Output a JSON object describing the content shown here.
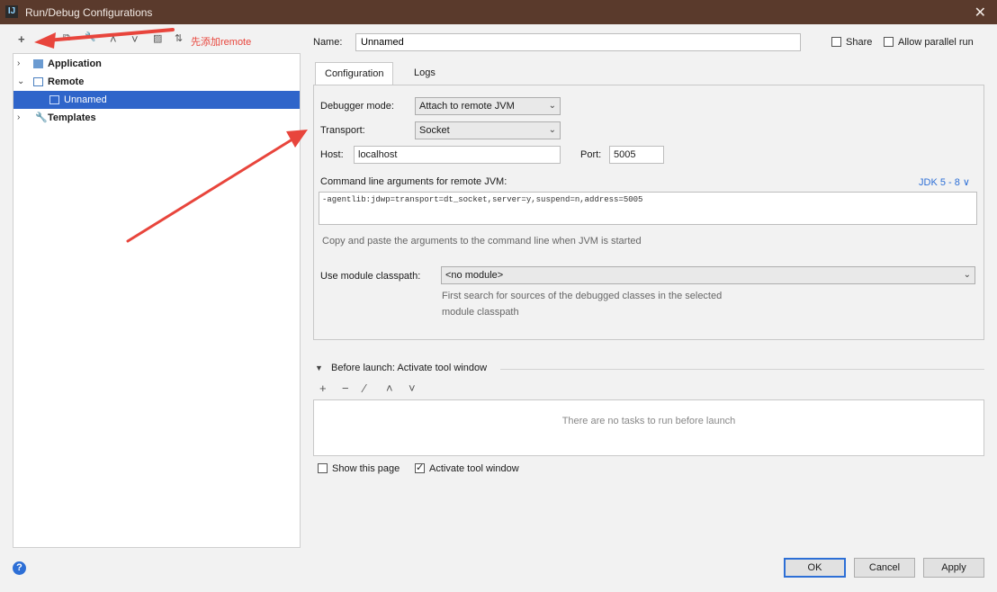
{
  "window": {
    "title": "Run/Debug Configurations",
    "app_icon": "IJ",
    "close_glyph": "✕"
  },
  "toolbar": {
    "add": "+",
    "remove": "−",
    "copy": "⧉",
    "edit": "🔧",
    "up": "˄",
    "down": "˅",
    "folder": "▨",
    "sort": "⇅",
    "annotation": "先添加remote"
  },
  "tree": {
    "application": "Application",
    "remote": "Remote",
    "unnamed": "Unnamed",
    "templates": "Templates",
    "collapsed_glyph": "›",
    "expanded_glyph": "⌄"
  },
  "form": {
    "name_label": "Name:",
    "name_value": "Unnamed",
    "share_label": "Share",
    "allow_parallel_label": "Allow parallel run",
    "tabs": [
      "Configuration",
      "Logs"
    ],
    "debugger_mode_label": "Debugger mode:",
    "debugger_mode_value": "Attach to remote JVM",
    "transport_label": "Transport:",
    "transport_value": "Socket",
    "host_label": "Host:",
    "host_value": "localhost",
    "port_label": "Port:",
    "port_value": "5005",
    "cmd_label": "Command line arguments for remote JVM:",
    "jdk_link": "JDK 5 - 8 ∨",
    "cmd_value": "-agentlib:jdwp=transport=dt_socket,server=y,suspend=n,address=5005",
    "cmd_hint": "Copy and paste the arguments to the command line when JVM is started",
    "module_label": "Use module classpath:",
    "module_value": "<no module>",
    "module_hint_1": "First search for sources of the debugged classes in the selected",
    "module_hint_2": "module classpath",
    "select_chevron": "⌄"
  },
  "before_launch": {
    "toggle": "▼",
    "title": "Before launch: Activate tool window",
    "add": "+",
    "remove": "−",
    "edit": "∕",
    "up": "˄",
    "down": "˅",
    "empty_text": "There are no tasks to run before launch",
    "show_page_label": "Show this page",
    "activate_label": "Activate tool window"
  },
  "buttons": {
    "ok": "OK",
    "cancel": "Cancel",
    "apply": "Apply",
    "help": "?"
  },
  "colors": {
    "titlebar": "#5a3a2c",
    "selection": "#2f65ca",
    "annotation": "#e8453c",
    "link": "#2d6fd6"
  }
}
